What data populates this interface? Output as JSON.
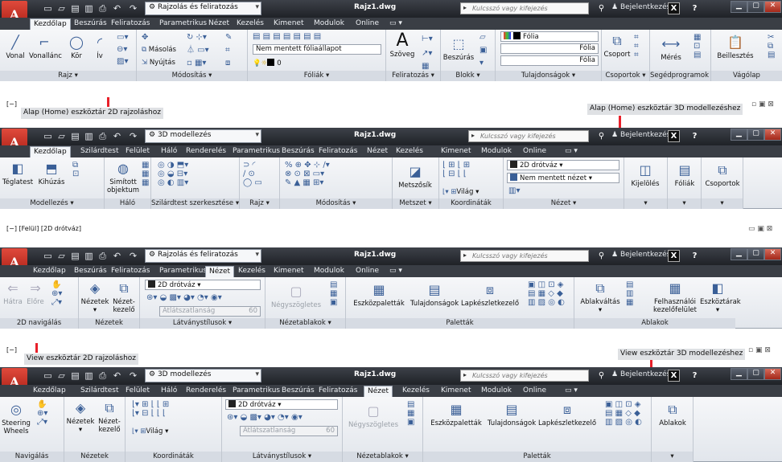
{
  "app": {
    "file_title": "Rajz1.dwg",
    "search_placeholder": "Kulcsszó vagy kifejezés",
    "login_label": "Bejelentkezés",
    "colors": {
      "titlebar": "#2b2e34",
      "ribbon": "#eef0f4",
      "accent_red": "#e8202a",
      "panel_label": "#d6dbe3"
    }
  },
  "annotations": {
    "ws1_caption": "Alap (Home) eszköztár 2D rajzoláshoz",
    "ws2_caption": "Alap (Home) eszköztár 3D modellezéshez",
    "ws3_caption": "View eszköztár 2D rajzoláshoz",
    "ws4_caption": "View eszköztár 3D modellezéshez"
  },
  "viewports": {
    "vp1": "[−]",
    "vp2": "[−] [Felül] [2D drótváz]",
    "vp3": "[−]"
  },
  "ws1": {
    "workspace": "Rajzolás és feliratozás",
    "tabs": [
      "Kezdőlap",
      "Beszúrás",
      "Feliratozás",
      "Parametrikus",
      "Nézet",
      "Kezelés",
      "Kimenet",
      "Modulok",
      "Online"
    ],
    "draw": {
      "label": "Rajz ▾",
      "vonal": "Vonal",
      "vonallanc": "Vonallánc",
      "kor": "Kör",
      "iv": "Ív"
    },
    "modify": {
      "label": "Módosítás ▾",
      "masolas": "Másolás",
      "nyujtas": "Nyújtás"
    },
    "layers": {
      "label": "Fóliák ▾",
      "layerstate": "Nem mentett fóliaállapot",
      "zero": "0"
    },
    "annot": {
      "label": "Feliratozás ▾",
      "szoveg": "Szöveg"
    },
    "block": {
      "label": "Blokk ▾",
      "beszuras": "Beszúrás"
    },
    "props": {
      "label": "Tulajdonságok ▾",
      "folia1": "Fólia",
      "folia2": "Fólia",
      "folia3": "Fólia"
    },
    "groups": {
      "label": "Csoportok ▾",
      "csoport": "Csoport"
    },
    "utils": {
      "label": "Segédprogramok ▾",
      "meres": "Mérés"
    },
    "clip": {
      "label": "Vágólap",
      "beillesztes": "Beillesztés"
    }
  },
  "ws2": {
    "workspace": "3D modellezés",
    "tabs": [
      "Kezdőlap",
      "Szilárdtest",
      "Felület",
      "Háló",
      "Renderelés",
      "Parametrikus",
      "Beszúrás",
      "Feliratozás",
      "Nézet",
      "Kezelés",
      "Kimenet",
      "Modulok",
      "Online"
    ],
    "model": {
      "label": "Modellezés ▾",
      "teglatest": "Téglatest",
      "kihuzas": "Kihúzás",
      "simitott": "Simított objektum"
    },
    "mesh": {
      "label": "Háló"
    },
    "solidedit": {
      "label": "Szilárdtest szerkesztése ▾"
    },
    "draw": {
      "label": "Rajz ▾"
    },
    "modify": {
      "label": "Módosítás ▾"
    },
    "section": {
      "label": "Metszet ▾",
      "metszosik": "Metszősík"
    },
    "coord": {
      "label": "Koordináták",
      "vilag": "Világ"
    },
    "view": {
      "label": "Nézet ▾",
      "style": "2D drótváz",
      "viewstate": "Nem mentett nézet"
    },
    "sel": {
      "kijeloles": "Kijelölés"
    },
    "layers": {
      "foliak": "Fóliák"
    },
    "groups": {
      "csoportok": "Csoportok"
    }
  },
  "ws3": {
    "workspace": "Rajzolás és feliratozás",
    "tabs": [
      "Kezdőlap",
      "Beszúrás",
      "Feliratozás",
      "Parametrikus",
      "Nézet",
      "Kezelés",
      "Kimenet",
      "Modulok",
      "Online"
    ],
    "nav": {
      "label": "2D navigálás",
      "hatra": "Hátra",
      "elore": "Előre"
    },
    "views": {
      "label": "Nézetek",
      "nezetek": "Nézetek",
      "kezelo": "Nézet-kezelő"
    },
    "vstyles": {
      "label": "Látványstílusok ▾",
      "style": "2D drótváz",
      "opacity_label": "Átlátszatlanság",
      "opacity": "60"
    },
    "vports": {
      "label": "Nézetablakok ▾",
      "negyszog": "Négyszögletes"
    },
    "palettes": {
      "label": "Paletták",
      "eszkoz": "Eszközpaletták",
      "tulaj": "Tulajdonságok",
      "lapkeszlet": "Lapkészletkezelő"
    },
    "windows": {
      "label": "Ablakok",
      "valtas": "Ablakváltás",
      "felulet": "Felhasználói kezelőfelület",
      "tarak": "Eszköztárak"
    }
  },
  "ws4": {
    "workspace": "3D modellezés",
    "tabs": [
      "Kezdőlap",
      "Szilárdtest",
      "Felület",
      "Háló",
      "Renderelés",
      "Parametrikus",
      "Beszúrás",
      "Feliratozás",
      "Nézet",
      "Kezelés",
      "Kimenet",
      "Modulok",
      "Online"
    ],
    "nav": {
      "label": "Navigálás",
      "steering": "Steering Wheels"
    },
    "views": {
      "label": "Nézetek",
      "nezetek": "Nézetek",
      "kezelo": "Nézet-kezelő"
    },
    "coord": {
      "label": "Koordináták",
      "vilag": "Világ"
    },
    "vstyles": {
      "label": "Látványstílusok ▾",
      "style": "2D drótváz",
      "opacity_label": "Átlátszatlanság",
      "opacity": "60"
    },
    "vports": {
      "label": "Nézetablakok ▾",
      "negyszog": "Négyszögletes"
    },
    "palettes": {
      "label": "Paletták",
      "eszkoz": "Eszközpaletták",
      "tulaj": "Tulajdonságok",
      "lapkeszlet": "Lapkészletkezelő"
    },
    "windows": {
      "ablakok": "Ablakok"
    }
  }
}
